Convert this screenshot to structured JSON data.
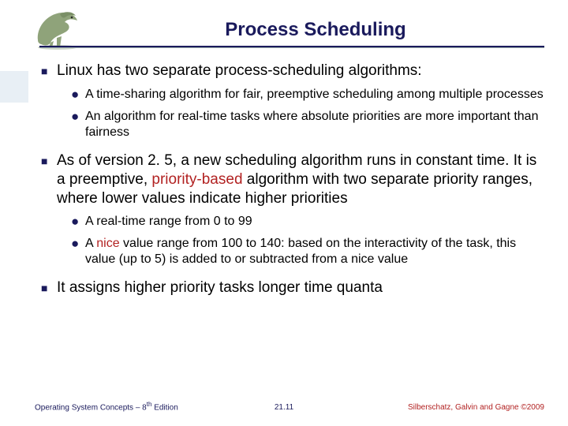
{
  "title": "Process Scheduling",
  "bullets": {
    "b1a": "Linux has two separate process-scheduling algorithms:",
    "b1a_sub1": "A time-sharing algorithm for fair, preemptive scheduling among multiple processes",
    "b1a_sub2": "An algorithm for real-time tasks where absolute priorities are more important than fairness",
    "b1b_pre": "As of version 2. 5, a new scheduling algorithm runs in constant time. It is a preemptive, ",
    "b1b_hl": "priority-based",
    "b1b_post": " algorithm with two separate priority ranges, where lower values indicate higher priorities",
    "b1b_sub1": "A real-time range from 0 to 99",
    "b1b_sub2_pre": "A ",
    "b1b_sub2_hl": "nice",
    "b1b_sub2_post": " value range from 100 to 140: based on the interactivity of the task, this value (up to 5) is added to or subtracted from a nice value",
    "b1c": "It assigns higher priority tasks longer time quanta"
  },
  "footer": {
    "left_a": "Operating System Concepts – 8",
    "left_b": "th",
    "left_c": " Edition",
    "center": "21.11",
    "right": "Silberschatz, Galvin and Gagne ©2009"
  }
}
